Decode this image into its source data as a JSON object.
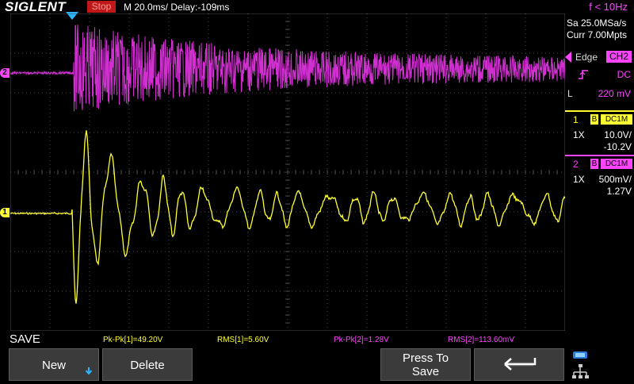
{
  "header": {
    "brand": "SIGLENT",
    "run_state": "Stop",
    "timebase": "M 20.0ms/ Delay:-109ms",
    "frequency": "f < 10Hz"
  },
  "right_panel": {
    "sample_rate": "Sa 25.0MSa/s",
    "memory": "Curr 7.00Mpts",
    "trigger": {
      "type": "Edge",
      "source": "CH2",
      "coupling": "DC",
      "mode": "L",
      "level": "220 mV"
    },
    "ch1": {
      "num": "1",
      "bw": "B",
      "coupling": "DC1M",
      "probe": "1X",
      "scale": "10.0V/",
      "offset": "-10.2V"
    },
    "ch2": {
      "num": "2",
      "bw": "B",
      "coupling": "DC1M",
      "probe": "1X",
      "scale": "500mV/",
      "offset": "1.27V"
    }
  },
  "channel_markers": {
    "ch1": "1",
    "ch2": "2"
  },
  "save_bar": {
    "title": "SAVE",
    "measurements": [
      {
        "label": "Pk-Pk[1]=49.20V",
        "color": "#ffff33"
      },
      {
        "label": "RMS[1]=5.60V",
        "color": "#ffff33"
      },
      {
        "label": "Pk-Pk[2]=1.28V",
        "color": "#ff44ff"
      },
      {
        "label": "RMS[2]=113.60mV",
        "color": "#ff44ff"
      }
    ]
  },
  "softkeys": {
    "new": "New",
    "delete": "Delete",
    "press_to_save_line1": "Press To",
    "press_to_save_line2": "Save"
  },
  "colors": {
    "ch1": "#ffff33",
    "ch2": "#e040e0",
    "trigger": "#ff44ff",
    "grid": "#4a4a4a"
  }
}
